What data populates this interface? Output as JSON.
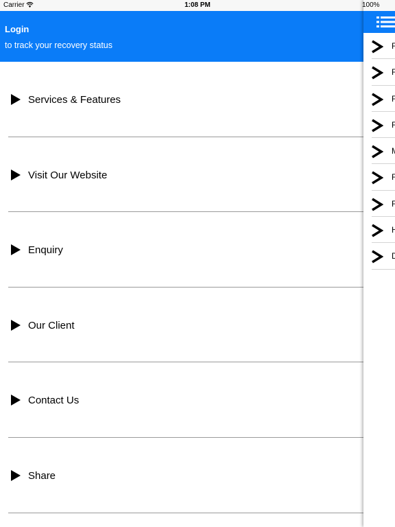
{
  "status_bar": {
    "carrier": "Carrier",
    "time": "1:08 PM",
    "battery": "100%"
  },
  "header": {
    "title": "Login",
    "subtitle": "to track your recovery status",
    "background": "#0a7cf8"
  },
  "menu": {
    "items": [
      {
        "label": "Services & Features"
      },
      {
        "label": "Visit Our Website"
      },
      {
        "label": "Enquiry"
      },
      {
        "label": "Our Client"
      },
      {
        "label": "Contact Us"
      },
      {
        "label": "Share"
      }
    ]
  },
  "drawer": {
    "menu_icon": "list-menu-icon",
    "items": [
      {
        "letter": "F"
      },
      {
        "letter": "F"
      },
      {
        "letter": "F"
      },
      {
        "letter": "F"
      },
      {
        "letter": "M"
      },
      {
        "letter": "F"
      },
      {
        "letter": "F"
      },
      {
        "letter": "H"
      },
      {
        "letter": "D"
      }
    ]
  }
}
